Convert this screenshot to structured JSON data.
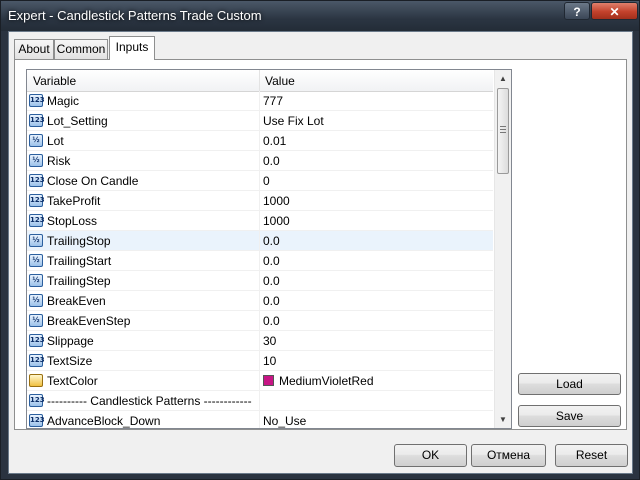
{
  "window": {
    "title": "Expert - Candlestick Patterns Trade Custom",
    "help_label": "?",
    "close_label": "✕"
  },
  "tabs": [
    "About",
    "Common",
    "Inputs"
  ],
  "active_tab": "Inputs",
  "table": {
    "headers": {
      "variable": "Variable",
      "value": "Value"
    },
    "rows": [
      {
        "icon": "int-icon",
        "icon_text": "123",
        "name": "Magic",
        "value": "777"
      },
      {
        "icon": "int-icon",
        "icon_text": "123",
        "name": "Lot_Setting",
        "value": "Use Fix Lot"
      },
      {
        "icon": "double-icon",
        "icon_text": "½",
        "name": "Lot",
        "value": "0.01"
      },
      {
        "icon": "double-icon",
        "icon_text": "½",
        "name": "Risk",
        "value": "0.0"
      },
      {
        "icon": "int-icon",
        "icon_text": "123",
        "name": "Close On Candle",
        "value": "0"
      },
      {
        "icon": "int-icon",
        "icon_text": "123",
        "name": "TakeProfit",
        "value": "1000"
      },
      {
        "icon": "int-icon",
        "icon_text": "123",
        "name": "StopLoss",
        "value": "1000"
      },
      {
        "icon": "double-icon",
        "icon_text": "½",
        "name": "TrailingStop",
        "value": "0.0",
        "selected": true
      },
      {
        "icon": "double-icon",
        "icon_text": "½",
        "name": "TrailingStart",
        "value": "0.0"
      },
      {
        "icon": "double-icon",
        "icon_text": "½",
        "name": "TrailingStep",
        "value": "0.0"
      },
      {
        "icon": "double-icon",
        "icon_text": "½",
        "name": "BreakEven",
        "value": "0.0"
      },
      {
        "icon": "double-icon",
        "icon_text": "½",
        "name": "BreakEvenStep",
        "value": "0.0"
      },
      {
        "icon": "int-icon",
        "icon_text": "123",
        "name": "Slippage",
        "value": "30"
      },
      {
        "icon": "int-icon",
        "icon_text": "123",
        "name": "TextSize",
        "value": "10"
      },
      {
        "icon": "color-icon",
        "icon_text": "",
        "name": "TextColor",
        "value": "MediumVioletRed",
        "swatch": "#c71585"
      },
      {
        "icon": "int-icon",
        "icon_text": "123",
        "name": "---------- Candlestick Patterns ------------",
        "value": ""
      },
      {
        "icon": "int-icon",
        "icon_text": "123",
        "name": "AdvanceBlock_Down",
        "value": "No_Use"
      }
    ]
  },
  "side_buttons": {
    "load": "Load",
    "save": "Save"
  },
  "footer_buttons": {
    "ok": "OK",
    "cancel": "Отмена",
    "reset": "Reset"
  },
  "colors": {
    "title_bar": "#2b3542",
    "close_button": "#c2412b",
    "selected_row": "#eaf3fc",
    "swatch": "#c71585"
  }
}
